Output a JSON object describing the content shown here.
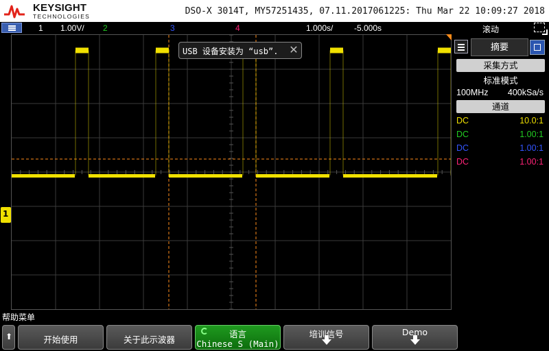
{
  "header": {
    "brand": "KEYSIGHT",
    "brand_sub": "TECHNOLOGIES",
    "model_info": "DSO-X 3014T, MY57251435, 07.11.2017061225: Thu Mar 22 10:09:27 2018"
  },
  "status_bar": {
    "ch1_label": "1",
    "ch1_scale": "1.00V/",
    "ch2_label": "2",
    "ch3_label": "3",
    "ch4_label": "4",
    "time_scale": "1.000s/",
    "delay": "-5.000s",
    "mode": "滚动",
    "colors": {
      "ch1": "#f0e000",
      "ch2": "#22cc22",
      "ch3": "#3355ff",
      "ch4": "#ff2277",
      "trigger": "#ff8c1a"
    }
  },
  "notification": {
    "text": "USB 设备安装为 “usb”."
  },
  "sidebar": {
    "tab_label": "摘要",
    "acquire_header": "采集方式",
    "acquire_mode": "标准模式",
    "bandwidth": "100MHz",
    "sample_rate": "400kSa/s",
    "channel_header": "通道",
    "channels": [
      {
        "coupling": "DC",
        "probe": "10.0:1",
        "color": "#f0e000"
      },
      {
        "coupling": "DC",
        "probe": "1.00:1",
        "color": "#22cc22"
      },
      {
        "coupling": "DC",
        "probe": "1.00:1",
        "color": "#3355ff"
      },
      {
        "coupling": "DC",
        "probe": "1.00:1",
        "color": "#ff2277"
      }
    ]
  },
  "waveform": {
    "ground_marker": "1",
    "channel": "ch1",
    "high_level_div": 3.55,
    "low_level_div": -0.1,
    "pulse_period_s": 1.0
  },
  "softkeys": {
    "menu_title": "帮助菜单",
    "up_label": "⬆",
    "keys": [
      {
        "label": "开始使用"
      },
      {
        "label": "关于此示波器"
      },
      {
        "label": "语言",
        "sub": "Chinese S (Main)"
      },
      {
        "label": "培训信号"
      },
      {
        "label": "Demo"
      }
    ]
  }
}
